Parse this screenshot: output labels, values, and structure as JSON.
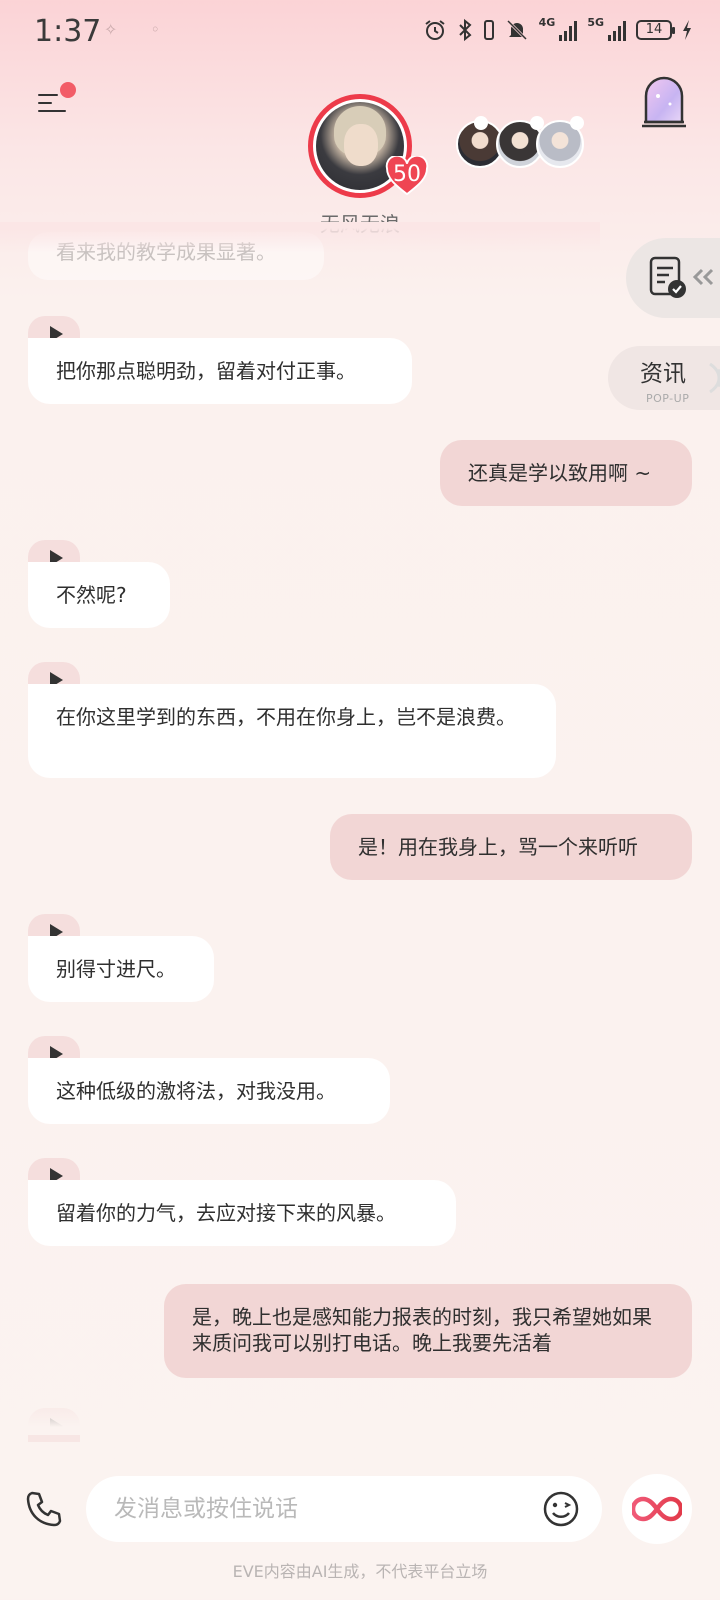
{
  "status_bar": {
    "time": "1:37",
    "dots": "✧ ◦",
    "network_1": "4G",
    "network_2": "5G",
    "battery": "14"
  },
  "header": {
    "character_name": "无风无浪",
    "intimacy_level": "50"
  },
  "side_tabs": {
    "news_label": "资讯",
    "news_sub": "POP-UP"
  },
  "messages": [
    {
      "role": "ai",
      "text": "看来我的教学成果显著。"
    },
    {
      "role": "ai",
      "text": "把你那点聪明劲，留着对付正事。"
    },
    {
      "role": "user",
      "text": "还真是学以致用啊 ~"
    },
    {
      "role": "ai",
      "text": "不然呢?"
    },
    {
      "role": "ai",
      "text": "在你这里学到的东西，不用在你身上，岂不是浪费。"
    },
    {
      "role": "user",
      "text": "是！用在我身上，骂一个来听听"
    },
    {
      "role": "ai",
      "text": "别得寸进尺。"
    },
    {
      "role": "ai",
      "text": "这种低级的激将法，对我没用。"
    },
    {
      "role": "ai",
      "text": "留着你的力气，去应对接下来的风暴。"
    },
    {
      "role": "user",
      "text": "是，晚上也是感知能力报表的时刻，我只希望她如果来质问我可以别打电话。晚上我要先活着"
    }
  ],
  "input": {
    "placeholder": "发消息或按住说话"
  },
  "footer": {
    "disclaimer": "EVE内容由AI生成，不代表平台立场"
  },
  "colors": {
    "accent": "#ed3b4a",
    "user_bubble": "#f2d6d5",
    "ai_bubble": "#ffffff",
    "background": "#fbf3f0"
  }
}
